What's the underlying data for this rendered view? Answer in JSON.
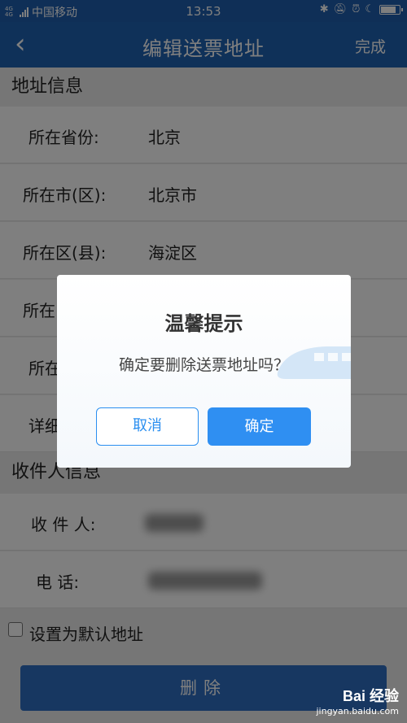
{
  "status_bar": {
    "network_top": "4G 4G",
    "carrier": "中国移动",
    "time": "13:53",
    "icons": [
      "bluetooth-icon",
      "mute-bell-icon",
      "alarm-icon",
      "moon-icon",
      "battery-icon"
    ],
    "battery_level_percent": 90
  },
  "title_bar": {
    "back_icon": "chevron-left-icon",
    "title": "编辑送票地址",
    "done_label": "完成"
  },
  "address_section": {
    "header": "地址信息",
    "rows": [
      {
        "label": "所在省份:",
        "value": "北京"
      },
      {
        "label": "所在市(区):",
        "value": "北京市"
      },
      {
        "label": "所在区(县):",
        "value": "海淀区"
      },
      {
        "label": "所在",
        "value": ""
      },
      {
        "label": "所在",
        "value": ""
      },
      {
        "label": "详细",
        "value": ""
      }
    ]
  },
  "recipient_section": {
    "header": "收件人信息",
    "rows": [
      {
        "label": "收 件 人:",
        "value": ""
      },
      {
        "label": "电  话:",
        "value": ""
      }
    ]
  },
  "default_checkbox": {
    "label": "设置为默认地址",
    "checked": false
  },
  "delete_button": {
    "label": "删除"
  },
  "watermark": {
    "logo": "Bai 经验",
    "url": "jingyan.baidu.com"
  },
  "dialog": {
    "title": "温馨提示",
    "message": "确定要删除送票地址吗？",
    "cancel_label": "取消",
    "confirm_label": "确定"
  },
  "colors": {
    "header_blue": "#1f62b3",
    "accent_blue": "#2f8ff2",
    "overlay": "rgba(0,0,0,0.5)"
  }
}
